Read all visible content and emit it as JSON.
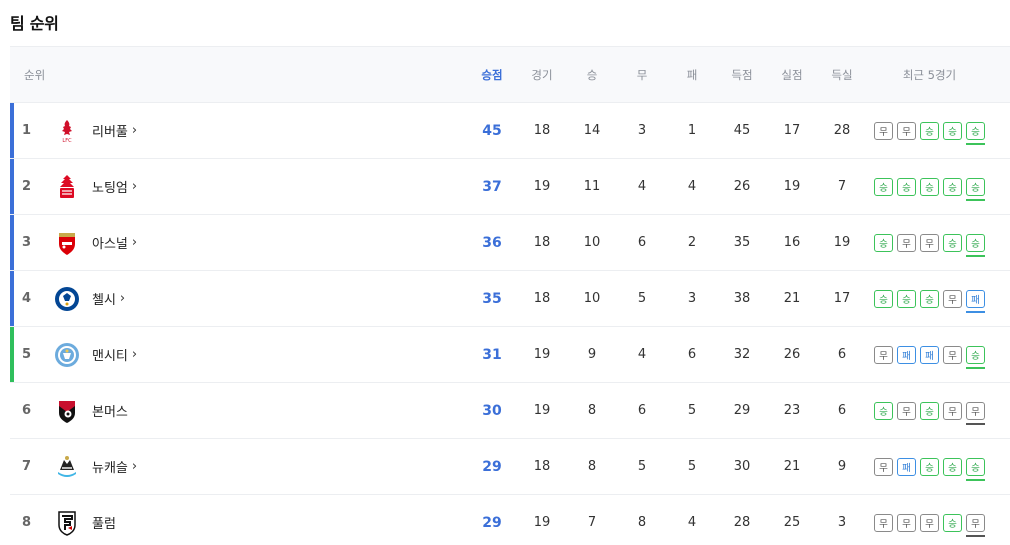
{
  "title": "팀 순위",
  "headers": {
    "rank": "순위",
    "points": "승점",
    "played": "경기",
    "won": "승",
    "drawn": "무",
    "lost": "패",
    "goals_for": "득점",
    "goals_against": "실점",
    "goal_diff": "득실",
    "form": "최근 5경기"
  },
  "colors": {
    "champions": "#3b6fd8",
    "europa": "#2fbf5c",
    "win": "#3cc35a",
    "draw": "#8a8a8a",
    "loss": "#3d8fe3",
    "points": "#3b6fd8"
  },
  "rows": [
    {
      "rank": "1",
      "team": "리버풀",
      "link": true,
      "zone": "champions",
      "logo": "liverpool-crest",
      "points": "45",
      "played": "18",
      "won": "14",
      "drawn": "3",
      "lost": "1",
      "gf": "45",
      "ga": "17",
      "gd": "28",
      "form": [
        "무",
        "무",
        "승",
        "승",
        "승"
      ]
    },
    {
      "rank": "2",
      "team": "노팅엄",
      "link": true,
      "zone": "champions",
      "logo": "nottingham-forest-crest",
      "points": "37",
      "played": "19",
      "won": "11",
      "drawn": "4",
      "lost": "4",
      "gf": "26",
      "ga": "19",
      "gd": "7",
      "form": [
        "승",
        "승",
        "승",
        "승",
        "승"
      ]
    },
    {
      "rank": "3",
      "team": "아스널",
      "link": true,
      "zone": "champions",
      "logo": "arsenal-crest",
      "points": "36",
      "played": "18",
      "won": "10",
      "drawn": "6",
      "lost": "2",
      "gf": "35",
      "ga": "16",
      "gd": "19",
      "form": [
        "승",
        "무",
        "무",
        "승",
        "승"
      ]
    },
    {
      "rank": "4",
      "team": "첼시",
      "link": true,
      "zone": "champions",
      "logo": "chelsea-crest",
      "points": "35",
      "played": "18",
      "won": "10",
      "drawn": "5",
      "lost": "3",
      "gf": "38",
      "ga": "21",
      "gd": "17",
      "form": [
        "승",
        "승",
        "승",
        "무",
        "패"
      ]
    },
    {
      "rank": "5",
      "team": "맨시티",
      "link": true,
      "zone": "europa",
      "logo": "man-city-crest",
      "points": "31",
      "played": "19",
      "won": "9",
      "drawn": "4",
      "lost": "6",
      "gf": "32",
      "ga": "26",
      "gd": "6",
      "form": [
        "무",
        "패",
        "패",
        "무",
        "승"
      ]
    },
    {
      "rank": "6",
      "team": "본머스",
      "link": false,
      "zone": "none",
      "logo": "bournemouth-crest",
      "points": "30",
      "played": "19",
      "won": "8",
      "drawn": "6",
      "lost": "5",
      "gf": "29",
      "ga": "23",
      "gd": "6",
      "form": [
        "승",
        "무",
        "승",
        "무",
        "무"
      ]
    },
    {
      "rank": "7",
      "team": "뉴캐슬",
      "link": true,
      "zone": "none",
      "logo": "newcastle-crest",
      "points": "29",
      "played": "18",
      "won": "8",
      "drawn": "5",
      "lost": "5",
      "gf": "30",
      "ga": "21",
      "gd": "9",
      "form": [
        "무",
        "패",
        "승",
        "승",
        "승"
      ]
    },
    {
      "rank": "8",
      "team": "풀럼",
      "link": false,
      "zone": "none",
      "logo": "fulham-crest",
      "points": "29",
      "played": "19",
      "won": "7",
      "drawn": "8",
      "lost": "4",
      "gf": "28",
      "ga": "25",
      "gd": "3",
      "form": [
        "무",
        "무",
        "무",
        "승",
        "무"
      ]
    }
  ]
}
